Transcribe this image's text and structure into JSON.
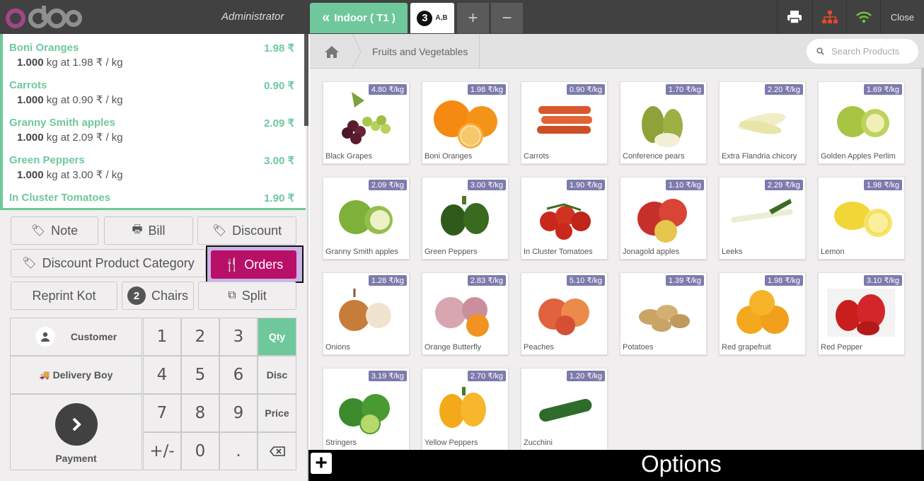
{
  "header": {
    "brand": "odoo",
    "user": "Administrator",
    "order_tab": "Indoor ( T1 )",
    "seats_count": "3",
    "seat_tables": "A,B",
    "add_icon": "+",
    "remove_icon": "−",
    "close_label": "Close",
    "icons": [
      "printer-icon",
      "network-icon",
      "wifi-icon"
    ]
  },
  "order": {
    "lines": [
      {
        "name": "Boni Oranges",
        "price": "1.98 ₹",
        "qty": "1.000",
        "info": " kg at 1.98 ₹ / kg"
      },
      {
        "name": "Carrots",
        "price": "0.90 ₹",
        "qty": "1.000",
        "info": " kg at 0.90 ₹ / kg"
      },
      {
        "name": "Granny Smith apples",
        "price": "2.09 ₹",
        "qty": "1.000",
        "info": " kg at 2.09 ₹ / kg"
      },
      {
        "name": "Green Peppers",
        "price": "3.00 ₹",
        "qty": "1.000",
        "info": " kg at 3.00 ₹ / kg"
      },
      {
        "name": "In Cluster Tomatoes",
        "price": "1.90 ₹",
        "qty": "",
        "info": ""
      }
    ]
  },
  "controls": {
    "note": "Note",
    "bill": "Bill",
    "discount": "Discount",
    "discount_category": "Discount Product Category",
    "orders": "Orders",
    "reprint": "Reprint Kot",
    "chairs_count": "2",
    "chairs": "Chairs",
    "split": "Split"
  },
  "numpad": {
    "customer": "Customer",
    "delivery_boy": "Delivery Boy",
    "payment": "Payment",
    "keys": [
      "1",
      "2",
      "3",
      "4",
      "5",
      "6",
      "7",
      "8",
      "9",
      "+/-",
      "0",
      "."
    ],
    "qty": "Qty",
    "disc": "Disc",
    "price": "Price",
    "accent": "#6ec89b"
  },
  "products_bar": {
    "category": "Fruits and Vegetables",
    "search_placeholder": "Search Products"
  },
  "products": [
    {
      "name": "Black Grapes",
      "price": "4.80 ₹/kg"
    },
    {
      "name": "Boni Oranges",
      "price": "1.98 ₹/kg"
    },
    {
      "name": "Carrots",
      "price": "0.90 ₹/kg"
    },
    {
      "name": "Conference pears",
      "price": "1.70 ₹/kg"
    },
    {
      "name": "Extra Flandria chicory",
      "price": "2.20 ₹/kg"
    },
    {
      "name": "Golden Apples Perlim",
      "price": "1.69 ₹/kg"
    },
    {
      "name": "Granny Smith apples",
      "price": "2.09 ₹/kg"
    },
    {
      "name": "Green Peppers",
      "price": "3.00 ₹/kg"
    },
    {
      "name": "In Cluster Tomatoes",
      "price": "1.90 ₹/kg"
    },
    {
      "name": "Jonagold apples",
      "price": "1.10 ₹/kg"
    },
    {
      "name": "Leeks",
      "price": "2.29 ₹/kg"
    },
    {
      "name": "Lemon",
      "price": "1.98 ₹/kg"
    },
    {
      "name": "Onions",
      "price": "1.28 ₹/kg"
    },
    {
      "name": "Orange Butterfly",
      "price": "2.83 ₹/kg"
    },
    {
      "name": "Peaches",
      "price": "5.10 ₹/kg"
    },
    {
      "name": "Potatoes",
      "price": "1.39 ₹/kg"
    },
    {
      "name": "Red grapefruit",
      "price": "1.98 ₹/kg"
    },
    {
      "name": "Red Pepper",
      "price": "3.10 ₹/kg"
    },
    {
      "name": "Stringers",
      "price": "3.19 ₹/kg"
    },
    {
      "name": "Yellow Peppers",
      "price": "2.70 ₹/kg"
    },
    {
      "name": "Zucchini",
      "price": "1.20 ₹/kg"
    }
  ],
  "footer": {
    "options": "Options"
  }
}
